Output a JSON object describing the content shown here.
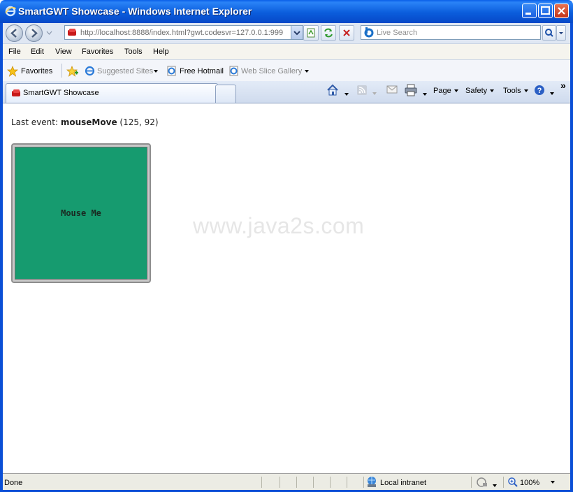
{
  "window": {
    "title": "SmartGWT Showcase - Windows Internet Explorer"
  },
  "address": {
    "url": "http://localhost:8888/index.html?gwt.codesvr=127.0.0.1:999"
  },
  "search": {
    "placeholder": "Live Search"
  },
  "menu": {
    "items": [
      "File",
      "Edit",
      "View",
      "Favorites",
      "Tools",
      "Help"
    ]
  },
  "favorites_bar": {
    "favorites_label": "Favorites",
    "suggested_sites": "Suggested Sites",
    "free_hotmail": "Free Hotmail",
    "web_slice_gallery": "Web Slice Gallery"
  },
  "tab": {
    "label": "SmartGWT Showcase"
  },
  "command_bar": {
    "page": "Page",
    "safety": "Safety",
    "tools": "Tools",
    "chevron": "»"
  },
  "content": {
    "last_event_prefix": "Last event: ",
    "last_event_name": "mouseMove",
    "last_event_coords": "(125, 92)",
    "box_label": "Mouse Me",
    "watermark": "www.java2s.com"
  },
  "status": {
    "text": "Done",
    "zone": "Local intranet",
    "zoom": "100%"
  },
  "colors": {
    "titlebar": "#0b5ddc",
    "box_fill": "#169b6f"
  }
}
